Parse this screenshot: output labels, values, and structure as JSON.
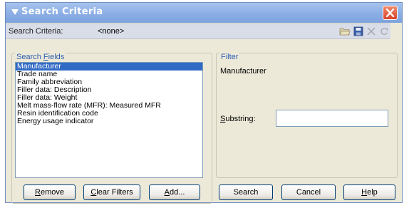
{
  "window": {
    "title": "Search Criteria"
  },
  "criteria": {
    "label": "Search Criteria:",
    "value": "<none>"
  },
  "toolbar": {
    "icons": [
      "open-folder-icon",
      "save-icon",
      "delete-icon",
      "refresh-icon"
    ]
  },
  "search_fields": {
    "title_prefix": "Search ",
    "title_accel": "F",
    "title_suffix": "ields",
    "items": [
      "Manufacturer",
      "Trade name",
      "Family abbreviation",
      "Filler data: Description",
      "Filler data: Weight",
      "Melt mass-flow rate (MFR): Measured MFR",
      "Resin identification code",
      "Energy usage indicator"
    ],
    "selected_index": 0
  },
  "filter": {
    "title": "Filter",
    "field_name": "Manufacturer",
    "substring_accel": "S",
    "substring_rest": "ubstring:",
    "substring_value": ""
  },
  "buttons": {
    "remove": {
      "accel": "R",
      "rest": "emove"
    },
    "clear_filters": {
      "accel": "C",
      "rest": "lear Filters"
    },
    "add": {
      "accel": "A",
      "rest": "dd..."
    },
    "search": "Search",
    "cancel": "Cancel",
    "help": {
      "accel": "H",
      "rest": "elp"
    }
  },
  "colors": {
    "title_bar": "#8aaee4",
    "selection": "#316ac5",
    "group_title": "#2f5fb3"
  }
}
